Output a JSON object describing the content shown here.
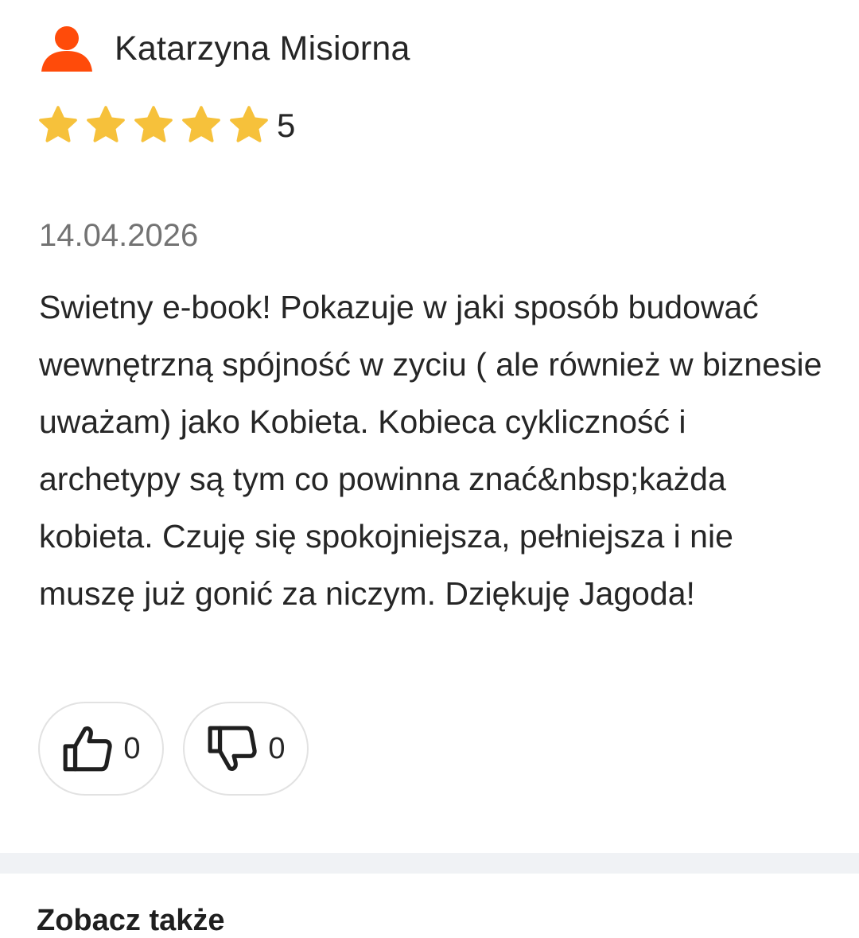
{
  "review": {
    "author": "Katarzyna Misiorna",
    "avatar_icon": "user-icon",
    "avatar_color": "#ff4b0a",
    "rating": {
      "value": 5,
      "max": 5,
      "label": "5",
      "star_color": "#f6c13b",
      "star_icon": "star-icon"
    },
    "date": "14.04.2026",
    "text": "Swietny e-book! Pokazuje w jaki sposób budować wewnętrzną spójność w zyciu ( ale również w biznesie uważam) jako Kobieta. Kobieca cykliczność i archetypy są tym co powinna znać&nbsp;każda kobieta. Czuję się spokojniejsza, pełniejsza i nie muszę już gonić za niczym. Dziękuję Jagoda!",
    "votes": {
      "up": {
        "icon": "thumbs-up-icon",
        "count": "0"
      },
      "down": {
        "icon": "thumbs-down-icon",
        "count": "0"
      }
    }
  },
  "next_section": {
    "title": "Zobacz także"
  },
  "colors": {
    "divider": "#f0f2f5",
    "button_border": "#e2e2e2",
    "date_text": "#737373"
  }
}
